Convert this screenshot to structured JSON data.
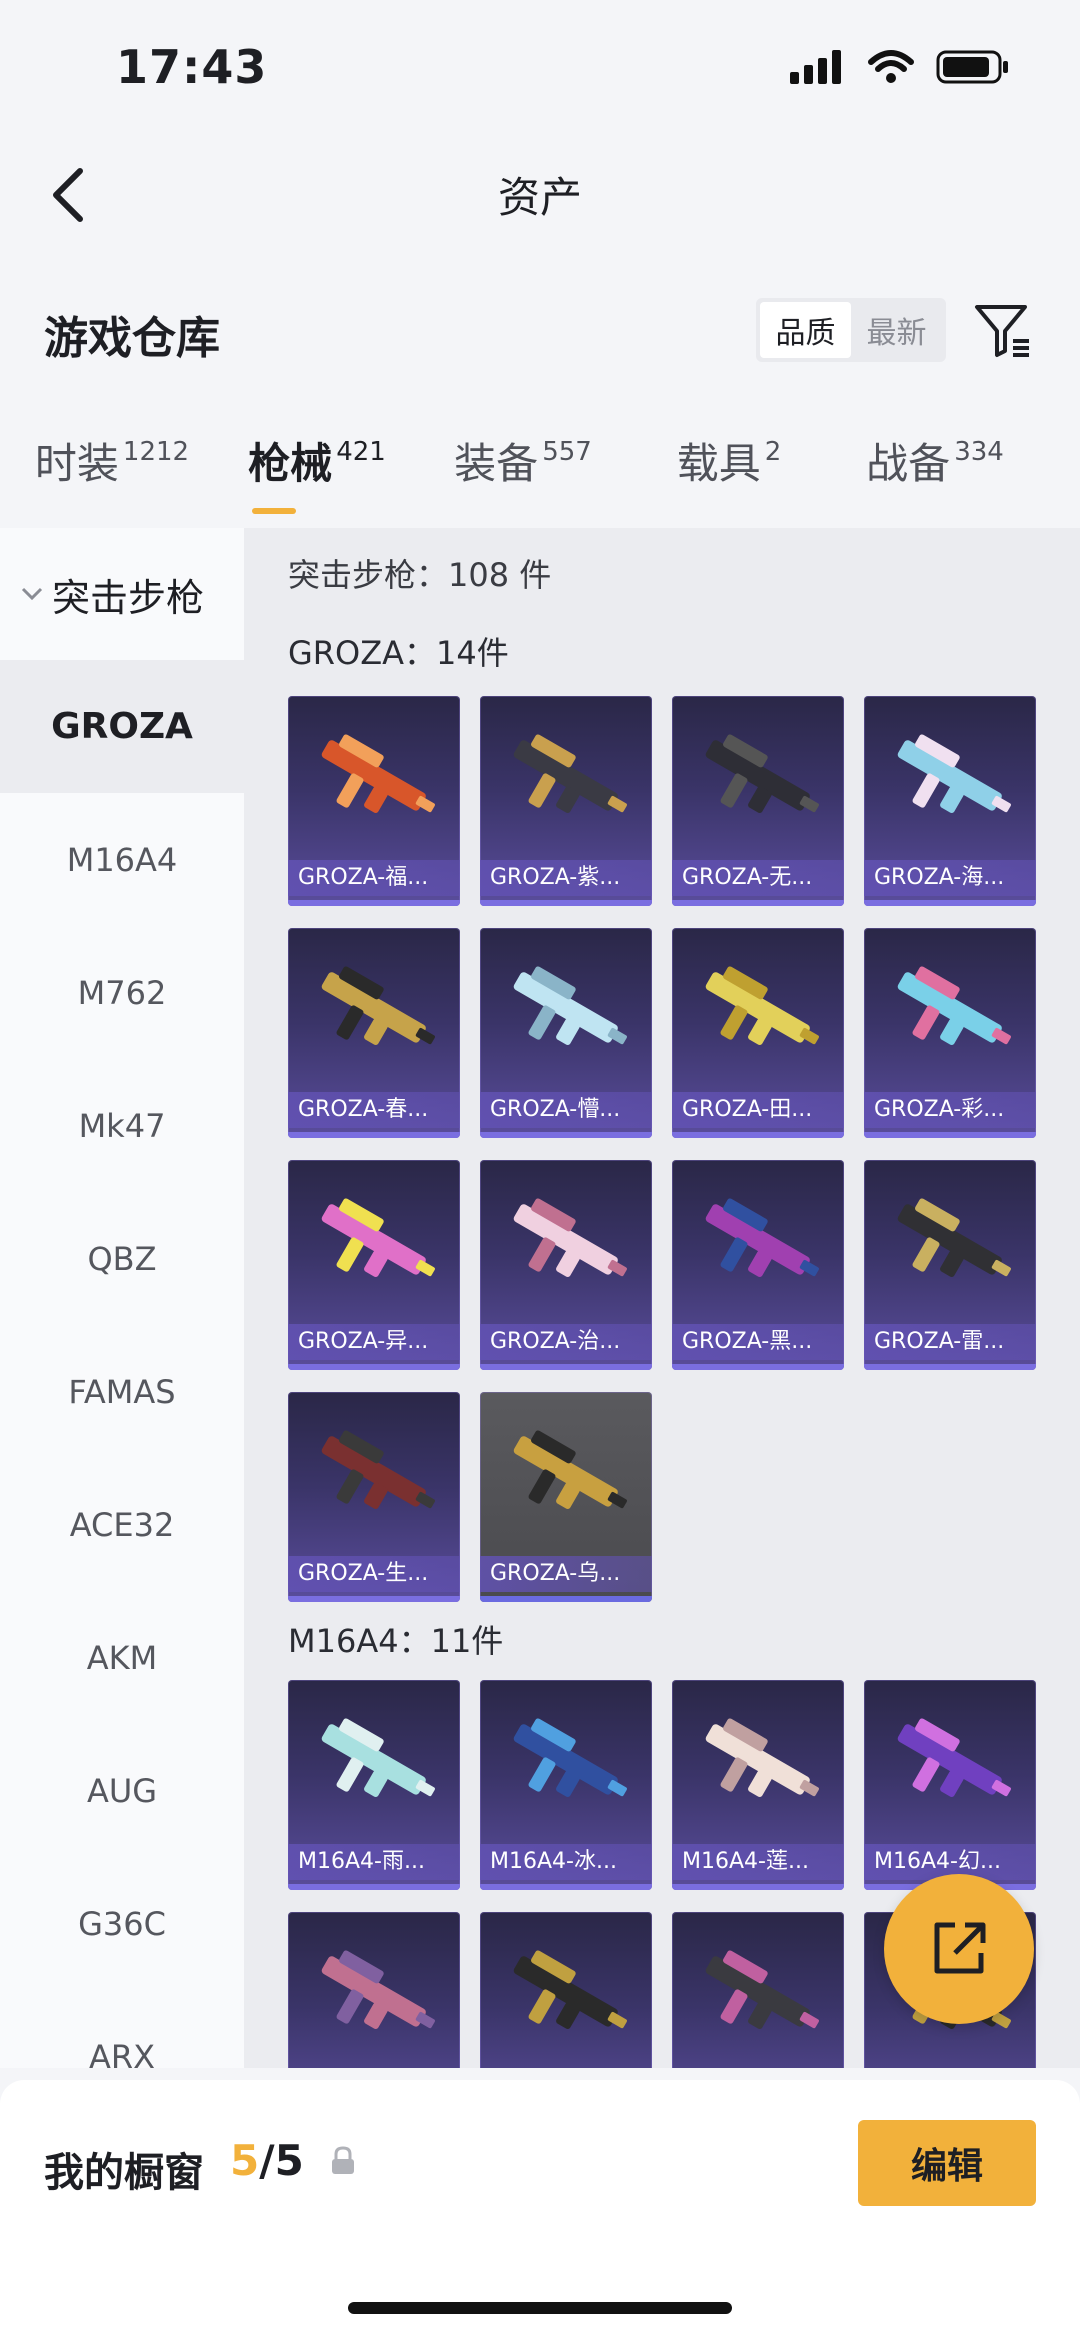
{
  "status_bar": {
    "time": "17:43"
  },
  "nav": {
    "title": "资产"
  },
  "section": {
    "title": "游戏仓库",
    "sort_options": [
      "品质",
      "最新"
    ]
  },
  "tabs": [
    {
      "label": "时装",
      "count": "1212"
    },
    {
      "label": "枪械",
      "count": "421"
    },
    {
      "label": "装备",
      "count": "557"
    },
    {
      "label": "载具",
      "count": "2"
    },
    {
      "label": "战备",
      "count": "334"
    }
  ],
  "sidebar": {
    "category": "突击步枪",
    "items": [
      "GROZA",
      "M16A4",
      "M762",
      "Mk47",
      "QBZ",
      "FAMAS",
      "ACE32",
      "AKM",
      "AUG",
      "G36C",
      "ARX"
    ]
  },
  "content": {
    "category_summary": "突击步枪：108 件",
    "groups": [
      {
        "label": "GROZA：14件",
        "cards": [
          "GROZA-福...",
          "GROZA-紫...",
          "GROZA-无...",
          "GROZA-海...",
          "GROZA-春...",
          "GROZA-懵...",
          "GROZA-田...",
          "GROZA-彩...",
          "GROZA-异...",
          "GROZA-治...",
          "GROZA-黑...",
          "GROZA-雷...",
          "GROZA-生...",
          "GROZA-乌..."
        ]
      },
      {
        "label": "M16A4：11件",
        "cards": [
          "M16A4-雨...",
          "M16A4-冰...",
          "M16A4-莲...",
          "M16A4-幻...",
          "",
          "",
          "",
          ""
        ]
      }
    ]
  },
  "bottom_bar": {
    "showcase_label": "我的橱窗",
    "current": "5",
    "total": "/5",
    "edit_label": "编辑"
  },
  "colors": {
    "accent": "#f2b13b",
    "card_purple": "#3a3468"
  }
}
